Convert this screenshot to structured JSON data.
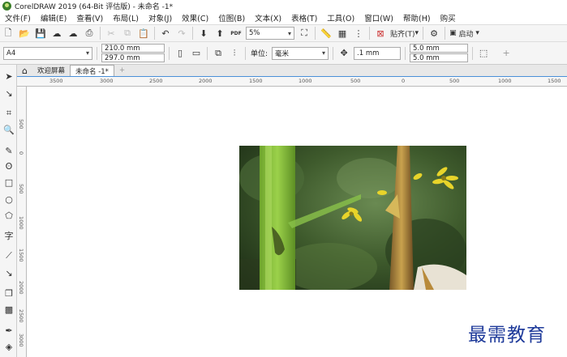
{
  "window": {
    "title": "CorelDRAW 2019 (64-Bit 评估版) - 未命名 -1*"
  },
  "menu": [
    "文件(F)",
    "编辑(E)",
    "查看(V)",
    "布局(L)",
    "对象(J)",
    "效果(C)",
    "位图(B)",
    "文本(X)",
    "表格(T)",
    "工具(O)",
    "窗口(W)",
    "帮助(H)",
    "购买"
  ],
  "toolbar": {
    "zoom_value": "5%",
    "snap_label": "贴齐(T)",
    "launch_label": "启动",
    "pdf_label": "PDF"
  },
  "property_bar": {
    "page_size": "A4",
    "width": "210.0 mm",
    "height": "297.0 mm",
    "units_label": "单位:",
    "units_value": "毫米",
    "nudge": ".1 mm",
    "dup_x": "5.0 mm",
    "dup_y": "5.0 mm"
  },
  "tabs": {
    "welcome": "欢迎屏幕",
    "doc": "未命名 -1*"
  },
  "ruler_h": [
    "3500",
    "3000",
    "2500",
    "2000",
    "1500",
    "1000",
    "500",
    "0",
    "500",
    "1000",
    "1500"
  ],
  "ruler_v": [
    "500",
    "0",
    "500",
    "1000",
    "1500",
    "2000",
    "2500",
    "3000"
  ],
  "watermark": "最需教育",
  "colors": {
    "accent": "#4a90d9",
    "watermark": "#1e3a9a"
  }
}
